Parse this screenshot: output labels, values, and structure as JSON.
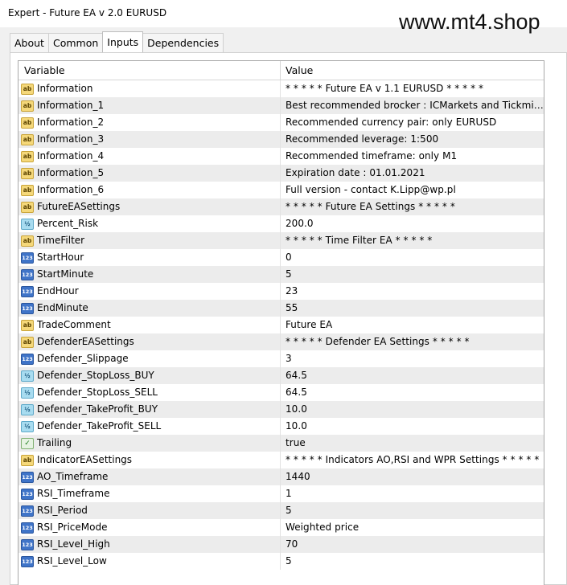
{
  "window": {
    "title": "Expert - Future EA v 2.0 EURUSD"
  },
  "watermark": "www.mt4.shop",
  "tabs": [
    {
      "label": "About"
    },
    {
      "label": "Common"
    },
    {
      "label": "Inputs",
      "active": true
    },
    {
      "label": "Dependencies"
    }
  ],
  "table": {
    "headers": {
      "variable": "Variable",
      "value": "Value"
    },
    "rows": [
      {
        "icon": "string",
        "variable": "Information",
        "value": "* * * * * Future EA v 1.1 EURUSD * * * * *"
      },
      {
        "icon": "string",
        "variable": "Information_1",
        "value": "Best recommended brocker : ICMarkets and Tickmill..."
      },
      {
        "icon": "string",
        "variable": "Information_2",
        "value": "Recommended currency pair: only EURUSD"
      },
      {
        "icon": "string",
        "variable": "Information_3",
        "value": "Recommended leverage: 1:500"
      },
      {
        "icon": "string",
        "variable": "Information_4",
        "value": "Recommended timeframe: only M1"
      },
      {
        "icon": "string",
        "variable": "Information_5",
        "value": "Expiration date : 01.01.2021"
      },
      {
        "icon": "string",
        "variable": "Information_6",
        "value": "Full version - contact K.Lipp@wp.pl"
      },
      {
        "icon": "string",
        "variable": "FutureEASettings",
        "value": "* * * * * Future EA Settings * * * * *"
      },
      {
        "icon": "double",
        "variable": "Percent_Risk",
        "value": "200.0"
      },
      {
        "icon": "string",
        "variable": "TimeFilter",
        "value": "* * * * * Time Filter EA * * * * *"
      },
      {
        "icon": "integer",
        "variable": "StartHour",
        "value": "0"
      },
      {
        "icon": "integer",
        "variable": "StartMinute",
        "value": "5"
      },
      {
        "icon": "integer",
        "variable": "EndHour",
        "value": "23"
      },
      {
        "icon": "integer",
        "variable": "EndMinute",
        "value": "55"
      },
      {
        "icon": "string",
        "variable": "TradeComment",
        "value": "Future EA"
      },
      {
        "icon": "string",
        "variable": "DefenderEASettings",
        "value": "* * * * * Defender EA Settings * * * * *"
      },
      {
        "icon": "integer",
        "variable": "Defender_Slippage",
        "value": "3"
      },
      {
        "icon": "double",
        "variable": "Defender_StopLoss_BUY",
        "value": "64.5"
      },
      {
        "icon": "double",
        "variable": "Defender_StopLoss_SELL",
        "value": "64.5"
      },
      {
        "icon": "double",
        "variable": "Defender_TakeProfit_BUY",
        "value": "10.0"
      },
      {
        "icon": "double",
        "variable": "Defender_TakeProfit_SELL",
        "value": "10.0"
      },
      {
        "icon": "bool",
        "variable": "Trailing",
        "value": "true"
      },
      {
        "icon": "string",
        "variable": "IndicatorEASettings",
        "value": "* * * * * Indicators AO,RSI and WPR Settings * * * * *"
      },
      {
        "icon": "integer",
        "variable": "AO_Timeframe",
        "value": "1440"
      },
      {
        "icon": "integer",
        "variable": "RSI_Timeframe",
        "value": "1"
      },
      {
        "icon": "integer",
        "variable": "RSI_Period",
        "value": "5"
      },
      {
        "icon": "integer",
        "variable": "RSI_PriceMode",
        "value": "Weighted price"
      },
      {
        "icon": "integer",
        "variable": "RSI_Level_High",
        "value": "70"
      },
      {
        "icon": "integer",
        "variable": "RSI_Level_Low",
        "value": "5"
      }
    ]
  },
  "icon_glyphs": {
    "string": "ab",
    "integer": "123",
    "double": "½",
    "bool": "✓"
  }
}
